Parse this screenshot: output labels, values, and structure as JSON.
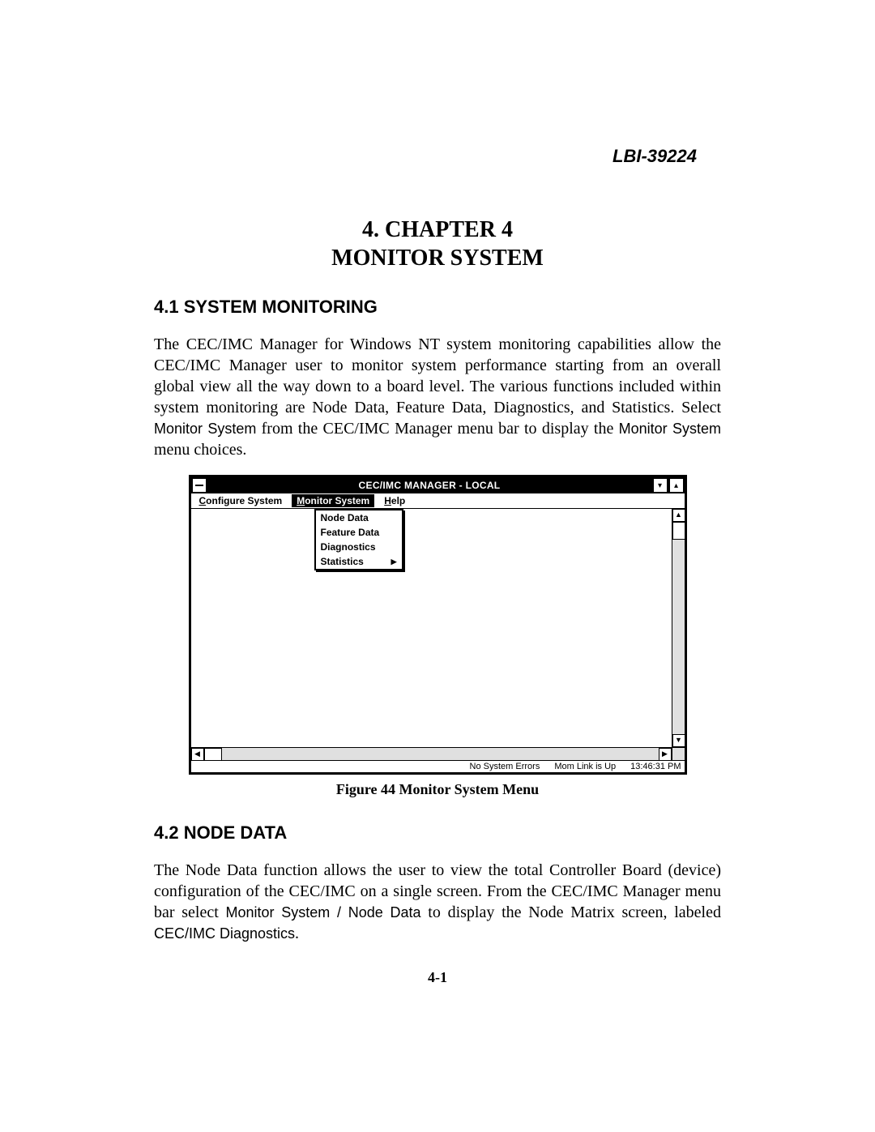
{
  "doc_id": "LBI-39224",
  "chapter": {
    "line1": "4.  CHAPTER 4",
    "line2": "MONITOR SYSTEM"
  },
  "section41": {
    "heading": "4.1  SYSTEM MONITORING",
    "text_pre": "The CEC/IMC Manager for Windows NT system monitoring capabilities allow the CEC/IMC Manager user to monitor system performance starting from an overall global view all the way down to a board level.  The various functions included within system monitoring are Node Data, Feature Data, Diagnostics, and Statistics.   Select ",
    "text_sans1": "Monitor System",
    "text_mid": " from the CEC/IMC Manager menu bar to display the ",
    "text_sans2": "Monitor System",
    "text_post": " menu choices."
  },
  "screenshot": {
    "title": "CEC/IMC MANAGER - LOCAL",
    "menubar": {
      "configure_html": "<u>C</u>onfigure System",
      "monitor_html": "<u>M</u>onitor System",
      "help_html": "<u>H</u>elp"
    },
    "dropdown": [
      "Node Data",
      "Feature Data",
      "Diagnostics",
      "Statistics"
    ],
    "status": {
      "errors": "No System Errors",
      "link": "Mom Link is Up",
      "time": "13:46:31 PM"
    }
  },
  "figure_caption": "Figure 44  Monitor System Menu",
  "section42": {
    "heading": "4.2  NODE DATA",
    "text_pre": "The Node Data function allows the user to view the total Controller Board (device) configuration of the CEC/IMC on a single screen.  From the CEC/IMC Manager menu bar select ",
    "text_sans1": "Monitor System / Node Data",
    "text_mid": " to display the Node Matrix screen, labeled ",
    "text_sans2": "CEC/IMC Diagnostics",
    "text_post": "."
  },
  "page_number": "4-1"
}
